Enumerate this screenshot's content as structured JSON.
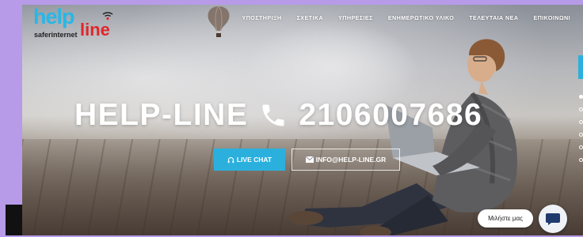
{
  "logo": {
    "help": "help",
    "line": "line",
    "tagline": "saferinternet"
  },
  "nav": [
    "ΥΠΟΣΤΗΡΙΞΗ",
    "ΣΧΕΤΙΚΑ",
    "ΥΠΗΡΕΣΙΕΣ",
    "ΕΝΗΜΕΡΩΤΙΚΟ ΥΛΙΚΟ",
    "ΤΕΛΕΥΤΑΙΑ ΝΕΑ",
    "ΕΠΙΚΟΙΝΩΝΙ"
  ],
  "hero": {
    "title_left": "HELP-LINE",
    "phone_number": "2106007686",
    "live_chat": "LIVE CHAT",
    "email": "INFO@HELP-LINE.GR"
  },
  "chat_widget": {
    "label": "Μιλήστε μας"
  },
  "colors": {
    "brand_blue": "#2bb0de",
    "brand_red": "#e1262a",
    "page_bg": "#b79be8"
  },
  "icons": [
    "phone-icon",
    "headset-icon",
    "envelope-icon",
    "wifi-icon",
    "chat-icon"
  ]
}
